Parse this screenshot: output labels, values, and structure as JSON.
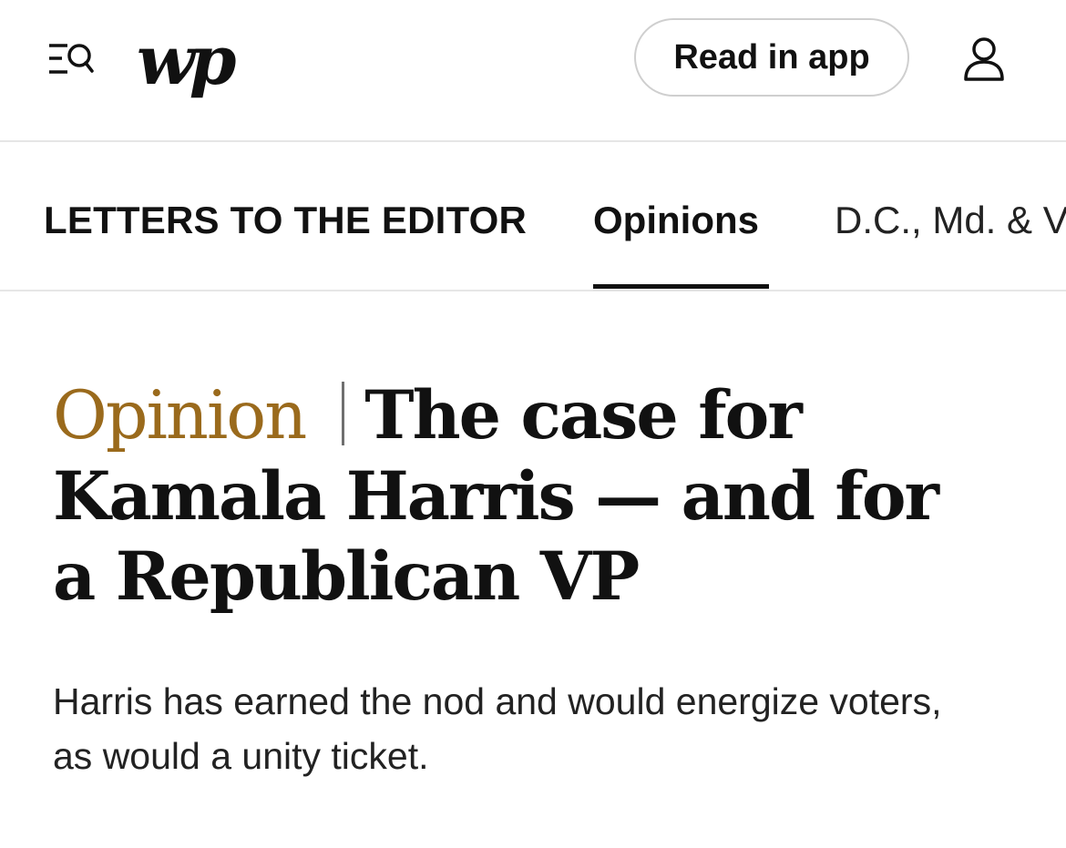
{
  "header": {
    "logo_text": "wp",
    "read_in_app_label": "Read in app",
    "icons": {
      "menu": "menu-search-icon",
      "account": "user-account-icon"
    }
  },
  "section_nav": {
    "brand_label": "LETTERS TO THE EDITOR",
    "items": [
      {
        "label": "Opinions",
        "active": true
      },
      {
        "label": "D.C., Md. & V",
        "active": false
      }
    ]
  },
  "article": {
    "label": "Opinion",
    "headline": "The case for Kamala Harris — and for a Republican VP",
    "subheadline": "Harris has earned the nod and would energize voters, as would a unity ticket."
  },
  "colors": {
    "opinion_accent": "#9a6a1c",
    "text": "#111111",
    "divider": "#e6e6e6"
  }
}
